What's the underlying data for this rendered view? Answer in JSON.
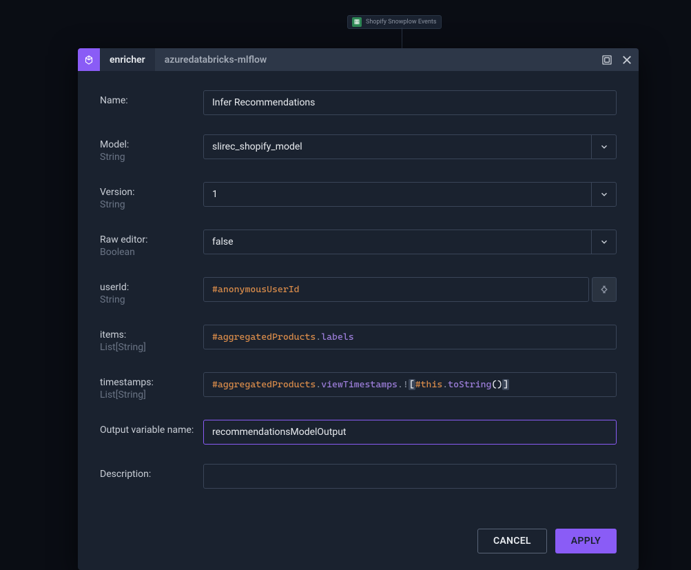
{
  "bg_node": {
    "label": "Shopify Snowplow Events"
  },
  "tabs": {
    "enricher": "enricher",
    "secondary": "azuredatabricks-mlflow"
  },
  "form": {
    "name": {
      "label": "Name:",
      "value": "Infer Recommendations"
    },
    "model": {
      "label": "Model:",
      "type": "String",
      "value": "slirec_shopify_model"
    },
    "version": {
      "label": "Version:",
      "type": "String",
      "value": "1"
    },
    "raw_editor": {
      "label": "Raw editor:",
      "type": "Boolean",
      "value": "false"
    },
    "userId": {
      "label": "userId:",
      "type": "String",
      "expr": {
        "parts": [
          {
            "t": "hash",
            "v": "#anonymousUserId"
          }
        ]
      }
    },
    "items": {
      "label": "items:",
      "type": "List[String]",
      "expr": {
        "parts": [
          {
            "t": "hash",
            "v": "#aggregatedProducts"
          },
          {
            "t": "dot",
            "v": "."
          },
          {
            "t": "prop",
            "v": "labels"
          }
        ]
      }
    },
    "timestamps": {
      "label": "timestamps:",
      "type": "List[String]",
      "expr": {
        "parts": [
          {
            "t": "hash",
            "v": "#aggregatedProducts"
          },
          {
            "t": "dot",
            "v": "."
          },
          {
            "t": "prop",
            "v": "viewTimestamps"
          },
          {
            "t": "dot",
            "v": ".!"
          },
          {
            "t": "bracket",
            "v": "["
          },
          {
            "t": "hash",
            "v": "#this"
          },
          {
            "t": "dot",
            "v": "."
          },
          {
            "t": "prop",
            "v": "toString"
          },
          {
            "t": "paren",
            "v": "()"
          },
          {
            "t": "bracket",
            "v": "]"
          }
        ]
      }
    },
    "output": {
      "label": "Output variable name:",
      "value": "recommendationsModelOutput"
    },
    "description": {
      "label": "Description:",
      "value": ""
    }
  },
  "buttons": {
    "cancel": "CANCEL",
    "apply": "APPLY"
  }
}
